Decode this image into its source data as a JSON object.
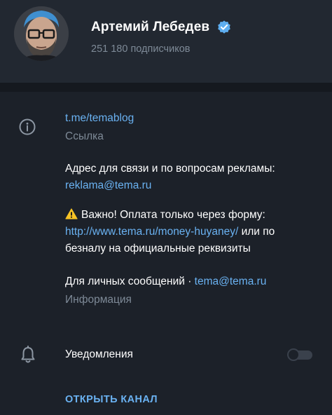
{
  "profile": {
    "name": "Артемий Лебедев",
    "subscribers": "251 180 подписчиков",
    "avatar_icon": "avatar-photo",
    "verified_icon": "verified-badge-icon"
  },
  "info": {
    "link": "t.me/temablog",
    "link_caption": "Ссылка",
    "contact_text": "Адрес для связи и по вопросам рекламы:",
    "contact_email": "reklama@tema.ru",
    "payment_text": "Важно! Оплата только через форму:",
    "payment_link": "http://www.tema.ru/money-huyaney/",
    "payment_text_2": " или по",
    "payment_text_3": "безналу на официальные реквизиты",
    "personal_text": "Для личных сообщений · ",
    "personal_email": "tema@tema.ru",
    "info_caption": "Информация"
  },
  "notifications": {
    "label": "Уведомления",
    "enabled": false
  },
  "actions": {
    "open_channel": "ОТКРЫТЬ КАНАЛ"
  },
  "colors": {
    "background": "#1c2129",
    "header": "#222831",
    "accent": "#6ab2f2",
    "muted": "#7e8a97",
    "verified": "#5eaef0"
  }
}
